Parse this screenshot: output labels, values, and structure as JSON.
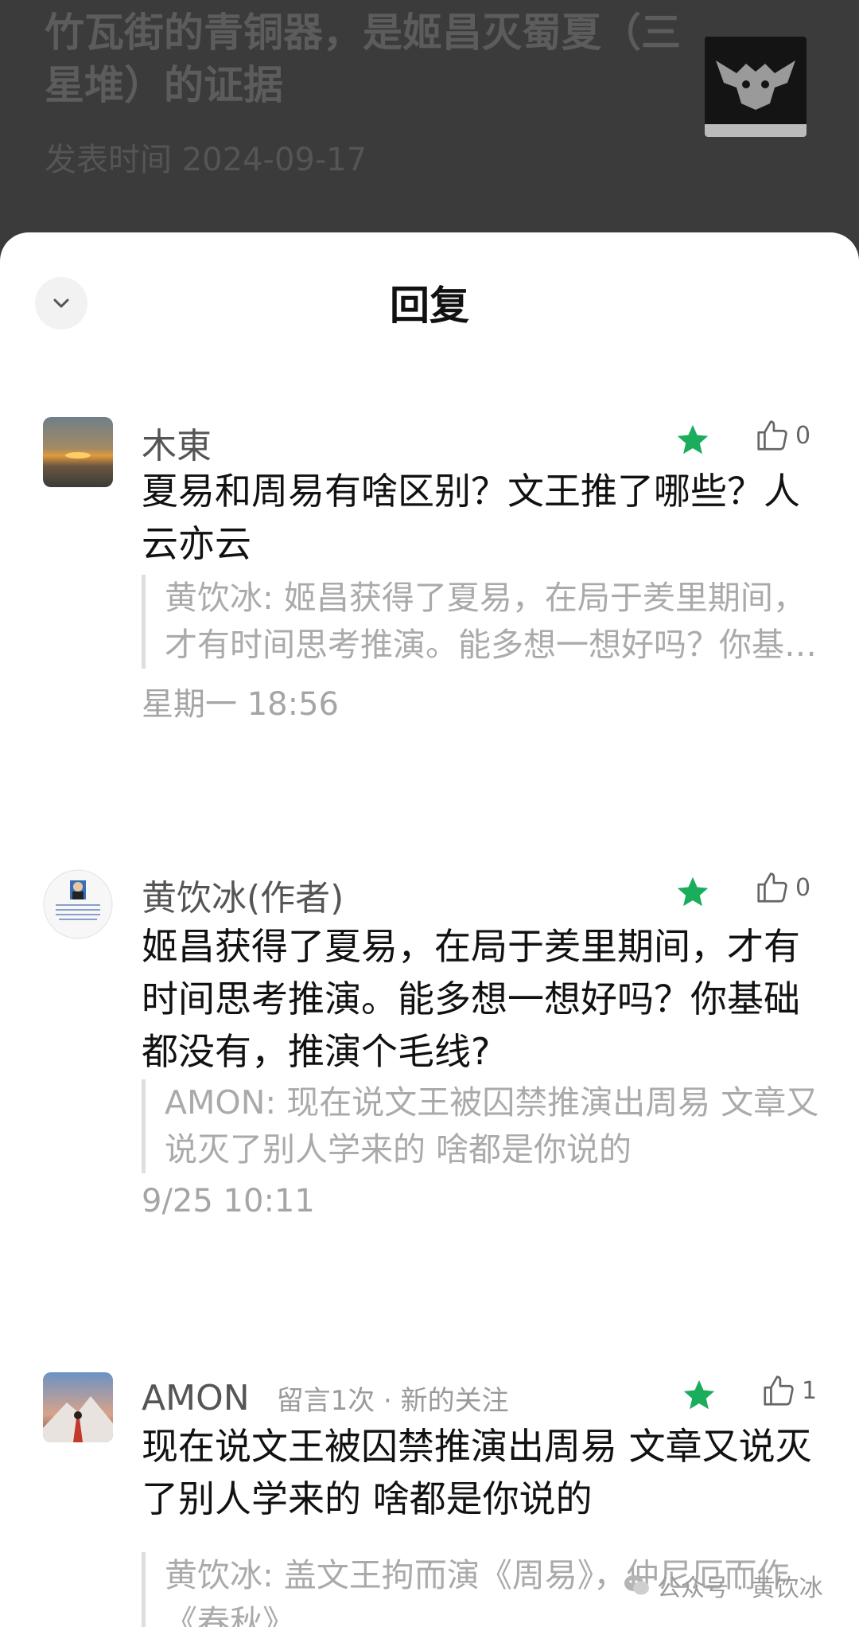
{
  "article": {
    "title": "竹瓦街的青铜器，是姬昌灭蜀夏（三星堆）的证据",
    "date": "发表时间 2024-09-17"
  },
  "sheet": {
    "title": "回复"
  },
  "comments": [
    {
      "author": "木東",
      "meta": "",
      "likes": "0",
      "text": "夏易和周易有啥区别？文王推了哪些？人云亦云",
      "quote": "黄饮冰: 姬昌获得了夏易，在局于羑里期间，才有时间思考推演。能多想一想好吗？你基础都没有，推演个毛线?",
      "time": "星期一  18:56"
    },
    {
      "author": "黄饮冰(作者)",
      "meta": "",
      "likes": "0",
      "text": "姬昌获得了夏易，在局于羑里期间，才有时间思考推演。能多想一想好吗？你基础都没有，推演个毛线?",
      "quote": "AMON: 现在说文王被囚禁推演出周易 文章又说灭了别人学来的 啥都是你说的",
      "time": "9/25 10:11"
    },
    {
      "author": "AMON",
      "meta": "留言1次 · 新的关注",
      "likes": "1",
      "text": "现在说文王被囚禁推演出周易 文章又说灭了别人学来的 啥都是你说的",
      "quote": "黄饮冰: 盖文王拘而演《周易》，仲尼厄而作《春秋》",
      "time": ""
    }
  ],
  "watermark": {
    "text": "公众号 · 黄饮冰"
  },
  "colors": {
    "star": "#1aad5b",
    "header_bg": "#3b3b3b",
    "sheet_bg": "#ffffff"
  },
  "icons": [
    "chevron-down-icon",
    "star-icon",
    "thumbs-up-icon",
    "wechat-icon"
  ]
}
